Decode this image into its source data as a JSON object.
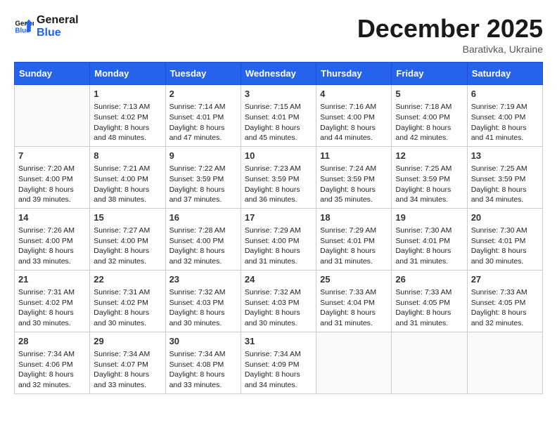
{
  "header": {
    "logo_line1": "General",
    "logo_line2": "Blue",
    "month": "December 2025",
    "location": "Barativka, Ukraine"
  },
  "weekdays": [
    "Sunday",
    "Monday",
    "Tuesday",
    "Wednesday",
    "Thursday",
    "Friday",
    "Saturday"
  ],
  "weeks": [
    [
      {
        "day": "",
        "info": ""
      },
      {
        "day": "1",
        "info": "Sunrise: 7:13 AM\nSunset: 4:02 PM\nDaylight: 8 hours\nand 48 minutes."
      },
      {
        "day": "2",
        "info": "Sunrise: 7:14 AM\nSunset: 4:01 PM\nDaylight: 8 hours\nand 47 minutes."
      },
      {
        "day": "3",
        "info": "Sunrise: 7:15 AM\nSunset: 4:01 PM\nDaylight: 8 hours\nand 45 minutes."
      },
      {
        "day": "4",
        "info": "Sunrise: 7:16 AM\nSunset: 4:00 PM\nDaylight: 8 hours\nand 44 minutes."
      },
      {
        "day": "5",
        "info": "Sunrise: 7:18 AM\nSunset: 4:00 PM\nDaylight: 8 hours\nand 42 minutes."
      },
      {
        "day": "6",
        "info": "Sunrise: 7:19 AM\nSunset: 4:00 PM\nDaylight: 8 hours\nand 41 minutes."
      }
    ],
    [
      {
        "day": "7",
        "info": "Sunrise: 7:20 AM\nSunset: 4:00 PM\nDaylight: 8 hours\nand 39 minutes."
      },
      {
        "day": "8",
        "info": "Sunrise: 7:21 AM\nSunset: 4:00 PM\nDaylight: 8 hours\nand 38 minutes."
      },
      {
        "day": "9",
        "info": "Sunrise: 7:22 AM\nSunset: 3:59 PM\nDaylight: 8 hours\nand 37 minutes."
      },
      {
        "day": "10",
        "info": "Sunrise: 7:23 AM\nSunset: 3:59 PM\nDaylight: 8 hours\nand 36 minutes."
      },
      {
        "day": "11",
        "info": "Sunrise: 7:24 AM\nSunset: 3:59 PM\nDaylight: 8 hours\nand 35 minutes."
      },
      {
        "day": "12",
        "info": "Sunrise: 7:25 AM\nSunset: 3:59 PM\nDaylight: 8 hours\nand 34 minutes."
      },
      {
        "day": "13",
        "info": "Sunrise: 7:25 AM\nSunset: 3:59 PM\nDaylight: 8 hours\nand 34 minutes."
      }
    ],
    [
      {
        "day": "14",
        "info": "Sunrise: 7:26 AM\nSunset: 4:00 PM\nDaylight: 8 hours\nand 33 minutes."
      },
      {
        "day": "15",
        "info": "Sunrise: 7:27 AM\nSunset: 4:00 PM\nDaylight: 8 hours\nand 32 minutes."
      },
      {
        "day": "16",
        "info": "Sunrise: 7:28 AM\nSunset: 4:00 PM\nDaylight: 8 hours\nand 32 minutes."
      },
      {
        "day": "17",
        "info": "Sunrise: 7:29 AM\nSunset: 4:00 PM\nDaylight: 8 hours\nand 31 minutes."
      },
      {
        "day": "18",
        "info": "Sunrise: 7:29 AM\nSunset: 4:01 PM\nDaylight: 8 hours\nand 31 minutes."
      },
      {
        "day": "19",
        "info": "Sunrise: 7:30 AM\nSunset: 4:01 PM\nDaylight: 8 hours\nand 31 minutes."
      },
      {
        "day": "20",
        "info": "Sunrise: 7:30 AM\nSunset: 4:01 PM\nDaylight: 8 hours\nand 30 minutes."
      }
    ],
    [
      {
        "day": "21",
        "info": "Sunrise: 7:31 AM\nSunset: 4:02 PM\nDaylight: 8 hours\nand 30 minutes."
      },
      {
        "day": "22",
        "info": "Sunrise: 7:31 AM\nSunset: 4:02 PM\nDaylight: 8 hours\nand 30 minutes."
      },
      {
        "day": "23",
        "info": "Sunrise: 7:32 AM\nSunset: 4:03 PM\nDaylight: 8 hours\nand 30 minutes."
      },
      {
        "day": "24",
        "info": "Sunrise: 7:32 AM\nSunset: 4:03 PM\nDaylight: 8 hours\nand 30 minutes."
      },
      {
        "day": "25",
        "info": "Sunrise: 7:33 AM\nSunset: 4:04 PM\nDaylight: 8 hours\nand 31 minutes."
      },
      {
        "day": "26",
        "info": "Sunrise: 7:33 AM\nSunset: 4:05 PM\nDaylight: 8 hours\nand 31 minutes."
      },
      {
        "day": "27",
        "info": "Sunrise: 7:33 AM\nSunset: 4:05 PM\nDaylight: 8 hours\nand 32 minutes."
      }
    ],
    [
      {
        "day": "28",
        "info": "Sunrise: 7:34 AM\nSunset: 4:06 PM\nDaylight: 8 hours\nand 32 minutes."
      },
      {
        "day": "29",
        "info": "Sunrise: 7:34 AM\nSunset: 4:07 PM\nDaylight: 8 hours\nand 33 minutes."
      },
      {
        "day": "30",
        "info": "Sunrise: 7:34 AM\nSunset: 4:08 PM\nDaylight: 8 hours\nand 33 minutes."
      },
      {
        "day": "31",
        "info": "Sunrise: 7:34 AM\nSunset: 4:09 PM\nDaylight: 8 hours\nand 34 minutes."
      },
      {
        "day": "",
        "info": ""
      },
      {
        "day": "",
        "info": ""
      },
      {
        "day": "",
        "info": ""
      }
    ]
  ]
}
